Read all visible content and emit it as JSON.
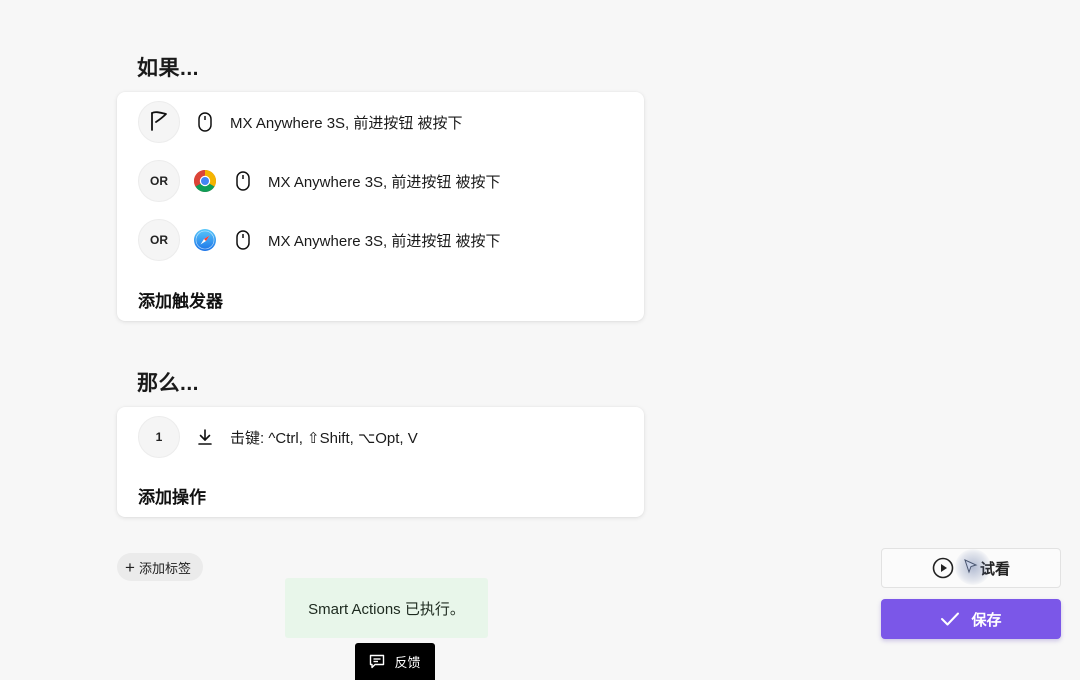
{
  "if_section": {
    "title": "如果...",
    "triggers": [
      {
        "badge_icon": "flag-icon",
        "app_icon": null,
        "device_icon": "mouse-icon",
        "text": "MX Anywhere 3S, 前进按钮 被按下"
      },
      {
        "badge": "OR",
        "app_icon": "chrome-icon",
        "device_icon": "mouse-icon",
        "text": "MX Anywhere 3S, 前进按钮 被按下"
      },
      {
        "badge": "OR",
        "app_icon": "safari-icon",
        "device_icon": "mouse-icon",
        "text": "MX Anywhere 3S, 前进按钮 被按下"
      }
    ],
    "add_label": "添加触发器"
  },
  "then_section": {
    "title": "那么...",
    "actions": [
      {
        "badge": "1",
        "icon": "download-icon",
        "text": "击键: ^Ctrl, ⇧Shift, ⌥Opt, V"
      }
    ],
    "add_label": "添加操作"
  },
  "tag_button": {
    "icon": "+",
    "label": "添加标签"
  },
  "toast": {
    "text": "Smart Actions 已执行。"
  },
  "feedback": {
    "label": "反馈",
    "icon": "feedback-icon"
  },
  "preview_button": {
    "label": "试看",
    "icon": "play-circle-icon"
  },
  "save_button": {
    "label": "保存",
    "icon": "check-icon"
  },
  "colors": {
    "accent": "#7b57e8",
    "toast_bg": "#e8f6ea",
    "background": "#f7f7f7"
  }
}
